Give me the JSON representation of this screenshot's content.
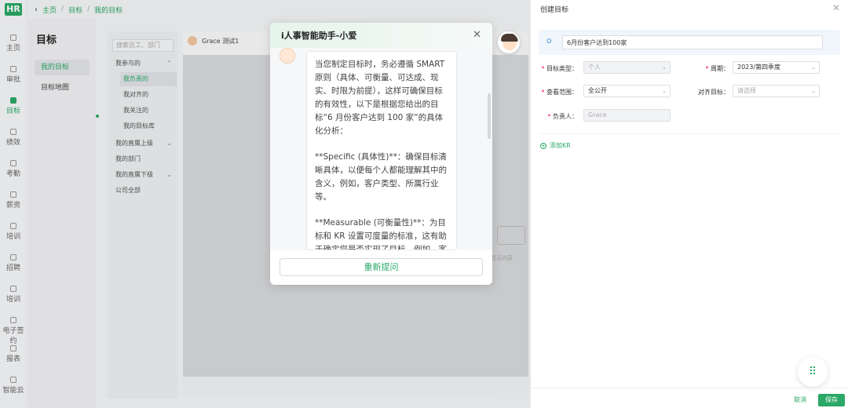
{
  "logo": "HR",
  "breadcrumb": [
    "主页",
    "目标",
    "我的目标"
  ],
  "nav": [
    {
      "label": "主页",
      "icon": "home-icon"
    },
    {
      "label": "审批",
      "icon": "approval-icon"
    },
    {
      "label": "目标",
      "icon": "target-icon",
      "active": true
    },
    {
      "label": "绩效",
      "icon": "performance-icon"
    },
    {
      "label": "考勤",
      "icon": "attendance-icon"
    },
    {
      "label": "薪资",
      "icon": "salary-icon"
    },
    {
      "label": "培训",
      "icon": "training-icon"
    },
    {
      "label": "招聘",
      "icon": "recruit-icon"
    },
    {
      "label": "培训",
      "icon": "training2-icon"
    },
    {
      "label": "电子签约",
      "icon": "esign-icon"
    },
    {
      "label": "报表",
      "icon": "report-icon"
    },
    {
      "label": "智能云",
      "icon": "cloud-icon"
    }
  ],
  "submenu": {
    "title": "目标",
    "items": [
      "我的目标",
      "目标地图"
    ]
  },
  "tree": {
    "search_placeholder": "搜索员工、部门",
    "items": [
      {
        "label": "我参与的",
        "level": 0,
        "expand": true
      },
      {
        "label": "我负责的",
        "level": 1,
        "active": true
      },
      {
        "label": "我对齐的",
        "level": 1
      },
      {
        "label": "我关注的",
        "level": 1
      },
      {
        "label": "我的目标库",
        "level": 1
      },
      {
        "label": "我的直属上级",
        "level": 0
      },
      {
        "label": "我的部门",
        "level": 0
      },
      {
        "label": "我的直属下级",
        "level": 0
      },
      {
        "label": "公司全部",
        "level": 0
      }
    ]
  },
  "main": {
    "person": "Grace 测试1",
    "empty_text": "暂无内容"
  },
  "modal": {
    "title": "i人事智能助手-小爱",
    "paragraphs": [
      "当您制定目标时，务必遵循 SMART 原则（具体、可衡量、可达成、现实、时限为前提），这样可确保目标的有效性，以下是根据您给出的目标“6 月份客户达到 100 家”的具体化分析：",
      "**Specific (具体性)**：确保目标清晰具体，以便每个人都能理解其中的含义，例如，客户类型、所属行业等。",
      "**Measurable (可衡量性)**：为目标和 KR 设置可度量的标准，这有助于确定您是否实现了目标。例如，客户"
    ],
    "ask_again": "重新提问"
  },
  "drawer": {
    "title": "创建目标",
    "goal_tag": "O",
    "goal_value": "6月份客户达到100家",
    "fields": {
      "type_label": "目标类型：",
      "type_value": "个人",
      "period_label": "周期：",
      "period_value": "2023/第四季度",
      "scope_label": "查看范围：",
      "scope_value": "全公开",
      "align_label": "对齐目标：",
      "align_placeholder": "请选择",
      "owner_label": "负责人：",
      "owner_value": "Grace"
    },
    "add_kr": "添加KR",
    "cancel": "取消",
    "save": "保存"
  }
}
